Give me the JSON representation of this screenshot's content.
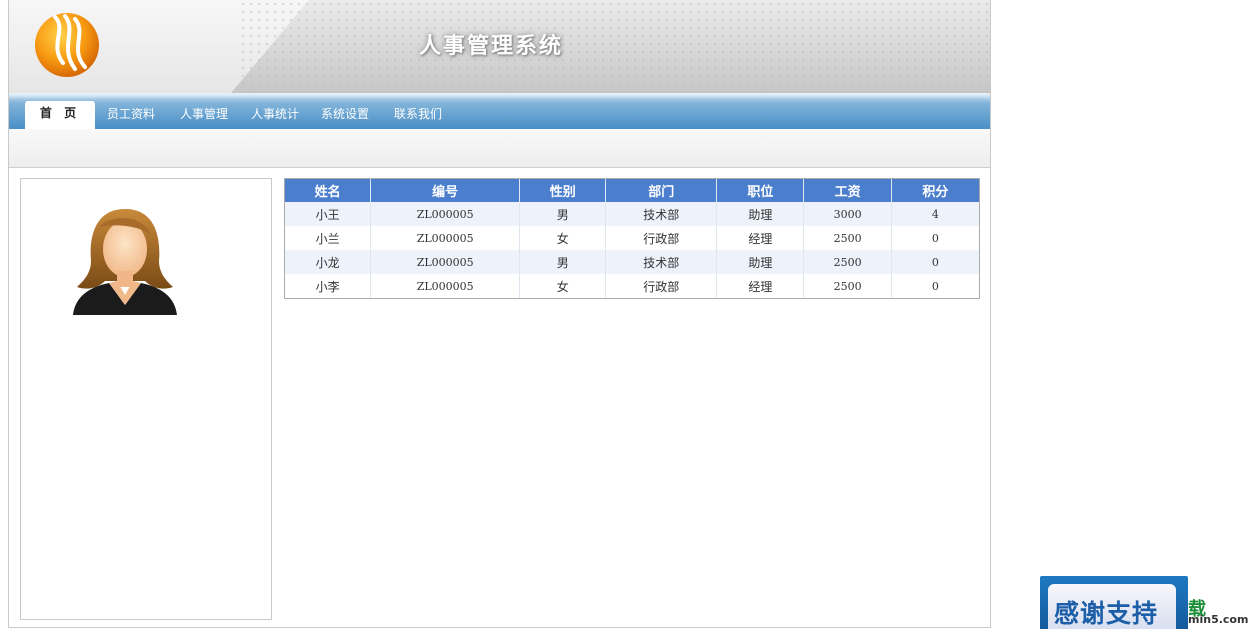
{
  "header": {
    "title": "人事管理系统"
  },
  "nav": {
    "items": [
      {
        "label": "首 页"
      },
      {
        "label": "员工资料"
      },
      {
        "label": "人事管理"
      },
      {
        "label": "人事统计"
      },
      {
        "label": "系统设置"
      },
      {
        "label": "联系我们"
      }
    ],
    "active": "首 页"
  },
  "table": {
    "headers": [
      "姓名",
      "编号",
      "性别",
      "部门",
      "职位",
      "工资",
      "积分"
    ],
    "rows": [
      [
        "小王",
        "ZL000005",
        "男",
        "技术部",
        "助理",
        "3000",
        "4"
      ],
      [
        "小兰",
        "ZL000005",
        "女",
        "行政部",
        "经理",
        "2500",
        "0"
      ],
      [
        "小龙",
        "ZL000005",
        "男",
        "技术部",
        "助理",
        "2500",
        "0"
      ],
      [
        "小李",
        "ZL000005",
        "女",
        "行政部",
        "经理",
        "2500",
        "0"
      ]
    ]
  },
  "badge": {
    "text": "感谢支持",
    "wm_char": "载",
    "wm_domain": "min5.com"
  },
  "colors": {
    "header_bg": "#4b7fce",
    "nav_blue": "#4a8fc6",
    "row_alt": "#eef3fb"
  }
}
